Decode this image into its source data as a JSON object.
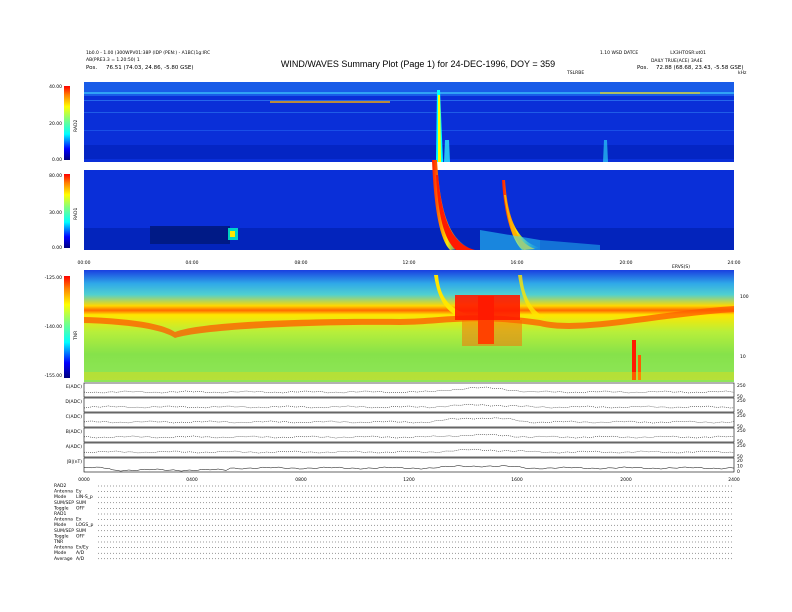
{
  "header": {
    "title": "WIND/WAVES Summary Plot (Page 1) for 24-DEC-1996, DOY = 359",
    "left_line1": "1b0.0 - 1.00 (300WPV01:38P (IDP (PEN:) - A1BC(1g:IRC",
    "left_line2": "AB(PRE3.3 = 1.20:50) 1",
    "left_pos_label": "Pos.",
    "left_pos_value": "76.51 (74.03, 24.86, -5.80 GSE)",
    "right_line1": "1.10 WSD DATCE",
    "right_line2": "DAILY TRUE(ACE) 3A4E",
    "right_pos_label": "Pos.",
    "right_pos_value": "72.88 (68.68, 23.43, -5.58 GSE)",
    "right_top": "LX3HTOSR:ot01",
    "center_small": "TSLRBE",
    "khz_label": "kHz"
  },
  "panels": {
    "rad2": {
      "label": "RAD2",
      "ticks": [
        "40.00",
        "20.00",
        "0.00"
      ]
    },
    "rad1": {
      "label": "RAD1",
      "ticks": [
        "80.00",
        "30.00",
        "0.00"
      ]
    },
    "tnr": {
      "label": "TNR",
      "ticks": [
        "-125.00",
        "-140.00",
        "-155.00"
      ],
      "right_ticks": [
        "100",
        "10"
      ]
    },
    "time_ticks": [
      "00:00",
      "04:00",
      "08:00",
      "12:00",
      "16:00",
      "20:00",
      "24:00"
    ],
    "time_ticks_bottom": [
      "0000",
      "0400",
      "0800",
      "1200",
      "1600",
      "2000",
      "2400"
    ],
    "secondary_time_label": "ERVS(S)"
  },
  "line_panels": [
    {
      "label": "E(ADC)",
      "right": [
        "250",
        "50"
      ]
    },
    {
      "label": "D(ADC)",
      "right": [
        "250",
        "50"
      ]
    },
    {
      "label": "C(ADC)",
      "right": [
        "250",
        "50"
      ]
    },
    {
      "label": "B(ADC)",
      "right": [
        "250",
        "50"
      ]
    },
    {
      "label": "A(ADC)",
      "right": [
        "250",
        "50"
      ]
    },
    {
      "label": "|B|(nT)",
      "right": [
        "20",
        "10",
        "0"
      ]
    }
  ],
  "footer": {
    "rows": [
      [
        "RAD2",
        ""
      ],
      [
        "Antenna",
        "Ey"
      ],
      [
        "Mode",
        "LIN-S_p"
      ],
      [
        "SUM/SEP",
        "SUM"
      ],
      [
        "Toggle",
        "OFF"
      ],
      [
        "RAD1",
        ""
      ],
      [
        "Antenna",
        "Ex"
      ],
      [
        "Mode",
        "LOGS_p"
      ],
      [
        "SUM/SEP",
        "SUM"
      ],
      [
        "Toggle",
        "OFF"
      ],
      [
        "TNR",
        ""
      ],
      [
        "Antenna",
        "Ex/Ey"
      ],
      [
        "Mode",
        "A/D"
      ],
      [
        "Average",
        "A/D"
      ]
    ]
  },
  "colors": {
    "spectrogram_background": "#0a2fd8",
    "burst_red": "#ff1a00",
    "burst_yellow": "#ffe600",
    "tnr_green": "#7be04a"
  }
}
